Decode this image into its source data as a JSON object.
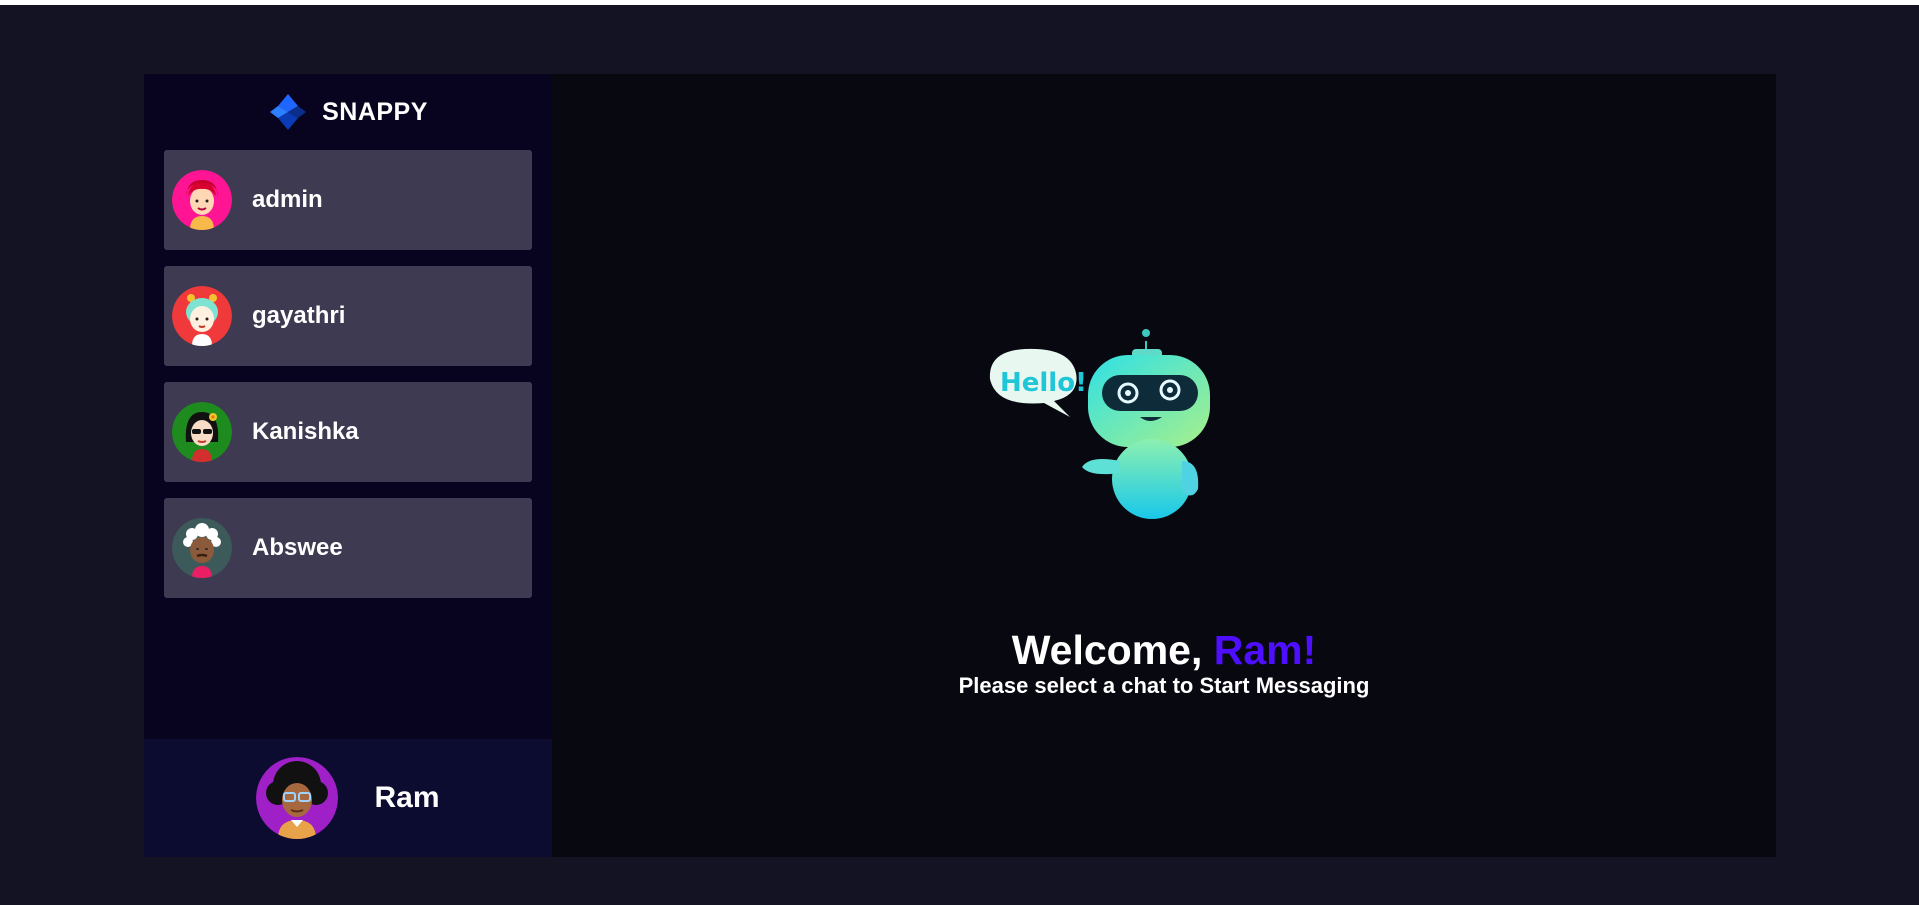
{
  "brand": {
    "name": "SNAPPY",
    "logo_icon": "snappy-logo-icon"
  },
  "contacts": [
    {
      "name": "admin",
      "avatar": "avatar-pink-hair",
      "color": "#ff1493"
    },
    {
      "name": "gayathri",
      "avatar": "avatar-teal-hair",
      "color": "#f0393a"
    },
    {
      "name": "Kanishka",
      "avatar": "avatar-glasses-flower",
      "color": "#1e8b1e"
    },
    {
      "name": "Abswee",
      "avatar": "avatar-white-hair",
      "color": "#3d5a5a"
    }
  ],
  "current_user": {
    "name": "Ram",
    "avatar": "avatar-afro-glasses",
    "color": "#a020c8"
  },
  "welcome": {
    "greeting": "Welcome, ",
    "username": "Ram!",
    "subtitle": "Please select a chat to Start Messaging",
    "bubble_text": "Hello!"
  },
  "colors": {
    "accent": "#4e0eff",
    "card": "#3d3a51",
    "sidebar": "#080420",
    "background": "#131324"
  }
}
